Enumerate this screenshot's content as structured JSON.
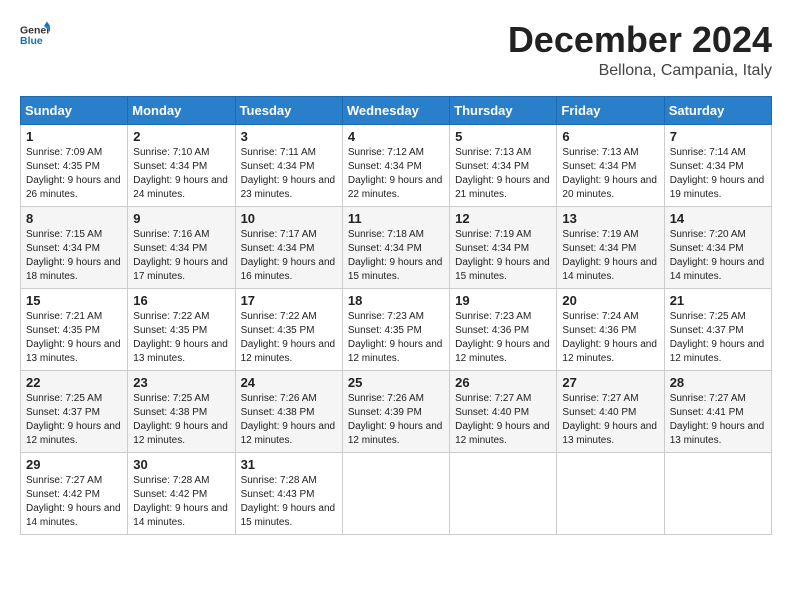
{
  "logo": {
    "general": "General",
    "blue": "Blue"
  },
  "title": "December 2024",
  "location": "Bellona, Campania, Italy",
  "days_of_week": [
    "Sunday",
    "Monday",
    "Tuesday",
    "Wednesday",
    "Thursday",
    "Friday",
    "Saturday"
  ],
  "weeks": [
    [
      {
        "day": "1",
        "sunrise": "7:09 AM",
        "sunset": "4:35 PM",
        "daylight": "9 hours and 26 minutes."
      },
      {
        "day": "2",
        "sunrise": "7:10 AM",
        "sunset": "4:34 PM",
        "daylight": "9 hours and 24 minutes."
      },
      {
        "day": "3",
        "sunrise": "7:11 AM",
        "sunset": "4:34 PM",
        "daylight": "9 hours and 23 minutes."
      },
      {
        "day": "4",
        "sunrise": "7:12 AM",
        "sunset": "4:34 PM",
        "daylight": "9 hours and 22 minutes."
      },
      {
        "day": "5",
        "sunrise": "7:13 AM",
        "sunset": "4:34 PM",
        "daylight": "9 hours and 21 minutes."
      },
      {
        "day": "6",
        "sunrise": "7:13 AM",
        "sunset": "4:34 PM",
        "daylight": "9 hours and 20 minutes."
      },
      {
        "day": "7",
        "sunrise": "7:14 AM",
        "sunset": "4:34 PM",
        "daylight": "9 hours and 19 minutes."
      }
    ],
    [
      {
        "day": "8",
        "sunrise": "7:15 AM",
        "sunset": "4:34 PM",
        "daylight": "9 hours and 18 minutes."
      },
      {
        "day": "9",
        "sunrise": "7:16 AM",
        "sunset": "4:34 PM",
        "daylight": "9 hours and 17 minutes."
      },
      {
        "day": "10",
        "sunrise": "7:17 AM",
        "sunset": "4:34 PM",
        "daylight": "9 hours and 16 minutes."
      },
      {
        "day": "11",
        "sunrise": "7:18 AM",
        "sunset": "4:34 PM",
        "daylight": "9 hours and 15 minutes."
      },
      {
        "day": "12",
        "sunrise": "7:19 AM",
        "sunset": "4:34 PM",
        "daylight": "9 hours and 15 minutes."
      },
      {
        "day": "13",
        "sunrise": "7:19 AM",
        "sunset": "4:34 PM",
        "daylight": "9 hours and 14 minutes."
      },
      {
        "day": "14",
        "sunrise": "7:20 AM",
        "sunset": "4:34 PM",
        "daylight": "9 hours and 14 minutes."
      }
    ],
    [
      {
        "day": "15",
        "sunrise": "7:21 AM",
        "sunset": "4:35 PM",
        "daylight": "9 hours and 13 minutes."
      },
      {
        "day": "16",
        "sunrise": "7:22 AM",
        "sunset": "4:35 PM",
        "daylight": "9 hours and 13 minutes."
      },
      {
        "day": "17",
        "sunrise": "7:22 AM",
        "sunset": "4:35 PM",
        "daylight": "9 hours and 12 minutes."
      },
      {
        "day": "18",
        "sunrise": "7:23 AM",
        "sunset": "4:35 PM",
        "daylight": "9 hours and 12 minutes."
      },
      {
        "day": "19",
        "sunrise": "7:23 AM",
        "sunset": "4:36 PM",
        "daylight": "9 hours and 12 minutes."
      },
      {
        "day": "20",
        "sunrise": "7:24 AM",
        "sunset": "4:36 PM",
        "daylight": "9 hours and 12 minutes."
      },
      {
        "day": "21",
        "sunrise": "7:25 AM",
        "sunset": "4:37 PM",
        "daylight": "9 hours and 12 minutes."
      }
    ],
    [
      {
        "day": "22",
        "sunrise": "7:25 AM",
        "sunset": "4:37 PM",
        "daylight": "9 hours and 12 minutes."
      },
      {
        "day": "23",
        "sunrise": "7:25 AM",
        "sunset": "4:38 PM",
        "daylight": "9 hours and 12 minutes."
      },
      {
        "day": "24",
        "sunrise": "7:26 AM",
        "sunset": "4:38 PM",
        "daylight": "9 hours and 12 minutes."
      },
      {
        "day": "25",
        "sunrise": "7:26 AM",
        "sunset": "4:39 PM",
        "daylight": "9 hours and 12 minutes."
      },
      {
        "day": "26",
        "sunrise": "7:27 AM",
        "sunset": "4:40 PM",
        "daylight": "9 hours and 12 minutes."
      },
      {
        "day": "27",
        "sunrise": "7:27 AM",
        "sunset": "4:40 PM",
        "daylight": "9 hours and 13 minutes."
      },
      {
        "day": "28",
        "sunrise": "7:27 AM",
        "sunset": "4:41 PM",
        "daylight": "9 hours and 13 minutes."
      }
    ],
    [
      {
        "day": "29",
        "sunrise": "7:27 AM",
        "sunset": "4:42 PM",
        "daylight": "9 hours and 14 minutes."
      },
      {
        "day": "30",
        "sunrise": "7:28 AM",
        "sunset": "4:42 PM",
        "daylight": "9 hours and 14 minutes."
      },
      {
        "day": "31",
        "sunrise": "7:28 AM",
        "sunset": "4:43 PM",
        "daylight": "9 hours and 15 minutes."
      },
      null,
      null,
      null,
      null
    ]
  ],
  "labels": {
    "sunrise": "Sunrise:",
    "sunset": "Sunset:",
    "daylight": "Daylight:"
  }
}
